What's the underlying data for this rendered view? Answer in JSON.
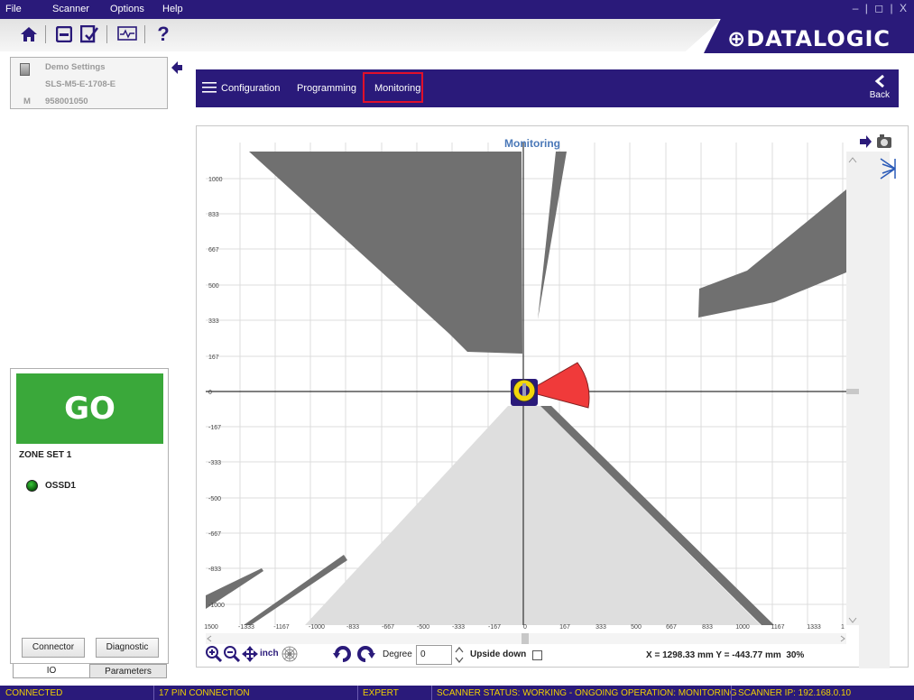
{
  "menubar": {
    "items": [
      "File",
      "Scanner",
      "Options",
      "Help"
    ],
    "window_controls": "– | ◻ | X"
  },
  "toolbar": {
    "icons": [
      "home-icon",
      "save-icon",
      "checklist-icon",
      "monitor-icon",
      "help-icon"
    ],
    "help_label": "?",
    "logo": "⊕DATALOGIC"
  },
  "device": {
    "name": "Demo Settings",
    "model": "SLS-M5-E-1708-E",
    "prefix": "M",
    "serial": "958001050"
  },
  "nav": {
    "items": [
      "Configuration",
      "Programming",
      "Monitoring"
    ],
    "active": "Monitoring",
    "back_label": "Back"
  },
  "status_panel": {
    "state": "GO",
    "zone_set": "ZONE SET 1",
    "ossd": "OSSD1",
    "buttons": [
      "Connector",
      "Diagnostic"
    ],
    "tabs": [
      "IO",
      "Parameters"
    ],
    "colors": {
      "go": "#3aa83a",
      "ossd": "#1a8a1a"
    }
  },
  "chart": {
    "title": "Monitoring",
    "y_ticks": [
      "1000",
      "833",
      "667",
      "500",
      "333",
      "167",
      "0",
      "-167",
      "-333",
      "-500",
      "-667",
      "-833",
      "-1000"
    ],
    "x_ticks": [
      "1500",
      "-1333",
      "-1167",
      "-1000",
      "-833",
      "-667",
      "-500",
      "-333",
      "-167",
      "0",
      "167",
      "333",
      "500",
      "667",
      "833",
      "1000",
      "1167",
      "1333",
      "1"
    ],
    "unit": "inch",
    "colors": {
      "obstacle": "#707070",
      "field": "#dedede",
      "warning": "#f03a3a",
      "axis": "#333333"
    }
  },
  "controls": {
    "degree_label": "Degree",
    "degree_value": "0",
    "upside_down_label": "Upside down",
    "upside_down_checked": false,
    "coords": "X = 1298.33 mm  Y = -443.77 mm",
    "zoom": "30%"
  },
  "statusbar": {
    "connection": "CONNECTED",
    "pins": "17 PIN CONNECTION",
    "mode": "EXPERT",
    "scanner_status": "SCANNER STATUS: WORKING - ONGOING OPERATION: MONITORING",
    "ip": "SCANNER IP: 192.168.0.10"
  }
}
